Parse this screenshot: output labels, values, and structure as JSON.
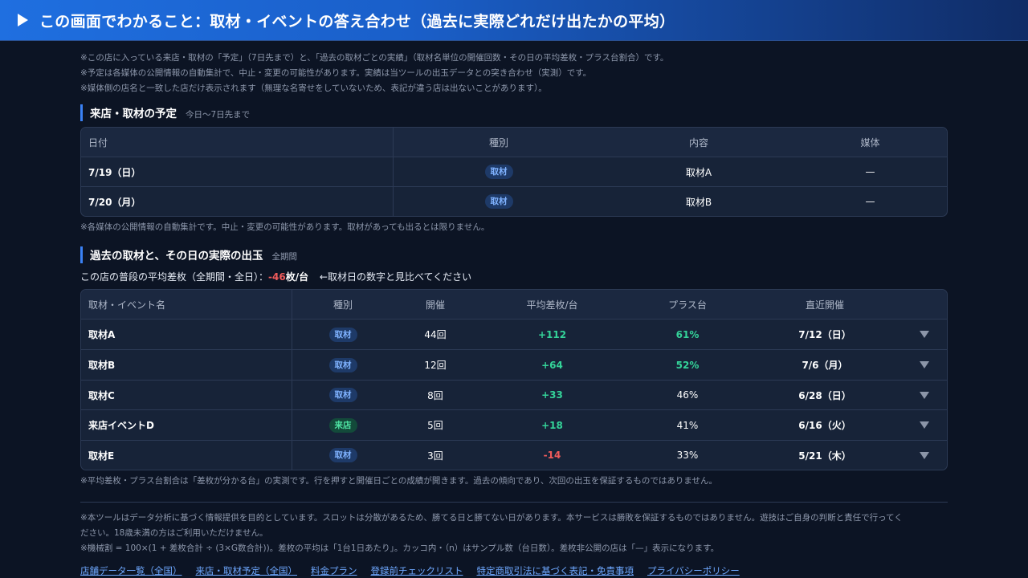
{
  "header": {
    "title": "この画面でわかること：取材・イベントの答え合わせ（過去に実際どれだけ出たかの平均）"
  },
  "notes": [
    "※この店に入っている来店・取材の「予定」（7日先まで）と、「過去の取材ごとの実績」（取材名単位の開催回数・その日の平均差枚・プラス台割合）です。",
    "※予定は各媒体の公開情報の自動集計で、中止・変更の可能性があります。実績は当ツールの出玉データとの突き合わせ（実測）です。",
    "※媒体側の店名と一致した店だけ表示されます（無理な名寄せをしていないため、表記が違う店は出ないことがあります）。"
  ],
  "schedule": {
    "title": "来店・取材の予定",
    "subtitle": "今日〜7日先まで",
    "columns": [
      "日付",
      "種別",
      "内容",
      "媒体"
    ],
    "rows": [
      {
        "date": "7/19（日）",
        "type": "取材",
        "content": "取材A",
        "media": "—"
      },
      {
        "date": "7/20（月）",
        "type": "取材",
        "content": "取材B",
        "media": "—"
      }
    ],
    "note": "※各媒体の公開情報の自動集計です。中止・変更の可能性があります。取材があっても出るとは限りません。"
  },
  "history": {
    "title": "過去の取材と、その日の実際の出玉",
    "subtitle": "全期間",
    "avg_prefix": "この店の普段の平均差枚（全期間・全日）：",
    "avg_value": "-46",
    "avg_unit": "枚/台",
    "avg_hint": "←取材日の数字と見比べてください",
    "columns": [
      "取材・イベント名",
      "種別",
      "開催",
      "平均差枚/台",
      "プラス台",
      "直近開催"
    ],
    "rows": [
      {
        "name": "取材A",
        "type": "取材",
        "count": "44回",
        "avg": "+112",
        "plus": "61%",
        "recent": "7/12（日）"
      },
      {
        "name": "取材B",
        "type": "取材",
        "count": "12回",
        "avg": "+64",
        "plus": "52%",
        "recent": "7/6（月）"
      },
      {
        "name": "取材C",
        "type": "取材",
        "count": "8回",
        "avg": "+33",
        "plus": "46%",
        "recent": "6/28（日）"
      },
      {
        "name": "来店イベントD",
        "type": "来店",
        "count": "5回",
        "avg": "+18",
        "plus": "41%",
        "recent": "6/16（火）"
      },
      {
        "name": "取材E",
        "type": "取材",
        "count": "3回",
        "avg": "-14",
        "plus": "33%",
        "recent": "5/21（木）"
      }
    ],
    "note": "※平均差枚・プラス台割合は「差枚が分かる台」の実測です。行を押すと開催日ごとの成績が開きます。過去の傾向であり、次回の出玉を保証するものではありません。"
  },
  "footer": {
    "disclaimer_line1": "※本ツールはデータ分析に基づく情報提供を目的としています。スロットは分散があるため、勝てる日と勝てない日があります。本サービスは勝敗を保証するものではありません。遊技はご自身の判断と責任で行ってく",
    "disclaimer_line2": "ださい。18歳未満の方はご利用いただけません。",
    "formula": "※機械割 = 100×(1 + 差枚合計 ÷ (3×G数合計))。差枚の平均は「1台1日あたり」。カッコ内・（n）はサンプル数（台日数）。差枚非公開の店は「—」表示になります。",
    "links": [
      "店舗データ一覧（全国）",
      "来店・取材予定（全国）",
      "料金プラン",
      "登録前チェックリスト",
      "特定商取引法に基づく表記・免責事項",
      "プライバシーポリシー"
    ]
  },
  "colors": {
    "accent": "#3b82f6",
    "positive": "#34d399",
    "negative": "#f05b5b",
    "link": "#6ea8ff"
  }
}
